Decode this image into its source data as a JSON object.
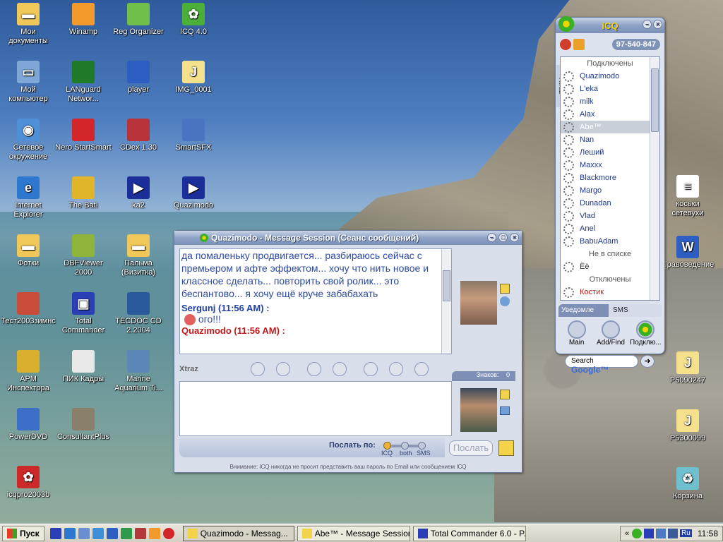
{
  "desktop_icons": [
    {
      "label": "Мои документы",
      "icon": "folder-icon",
      "color": "#f0c85a"
    },
    {
      "label": "Winamp",
      "icon": "winamp-icon",
      "color": "#f29a2b"
    },
    {
      "label": "Reg Organizer",
      "icon": "reg-organizer-icon",
      "color": "#6fbf4a"
    },
    {
      "label": "ICQ 4.0",
      "icon": "icq-flower-icon",
      "color": "#4caf3a"
    },
    {
      "label": "Мой компьютер",
      "icon": "computer-icon",
      "color": "#7ea7d8"
    },
    {
      "label": "LANguard Networ...",
      "icon": "radar-icon",
      "color": "#1f7a2a"
    },
    {
      "label": "player",
      "icon": "player-icon",
      "color": "#2f5ec2"
    },
    {
      "label": "IMG_0001",
      "icon": "jpg-icon",
      "color": "#f5e08c"
    },
    {
      "label": "Сетевое окружение",
      "icon": "network-icon",
      "color": "#4f8fd8"
    },
    {
      "label": "Nero StartSmart",
      "icon": "nero-icon",
      "color": "#d3262b"
    },
    {
      "label": "CDex 1.30",
      "icon": "cdex-icon",
      "color": "#b9333a"
    },
    {
      "label": "SmartSFX",
      "icon": "smartsfx-icon",
      "color": "#4a74c2"
    },
    {
      "label": "Internet Explorer",
      "icon": "ie-icon",
      "color": "#2f78d0"
    },
    {
      "label": "The Bat!",
      "icon": "bat-icon",
      "color": "#e0b52a"
    },
    {
      "label": "ka2",
      "icon": "play-shortcut-icon",
      "color": "#1c2e9a"
    },
    {
      "label": "Quazimodo",
      "icon": "play-shortcut-icon",
      "color": "#1c2e9a"
    },
    {
      "label": "Фотки",
      "icon": "folder-icon",
      "color": "#f0c85a"
    },
    {
      "label": "DBFViewer 2000",
      "icon": "dbf-icon",
      "color": "#8fb43c"
    },
    {
      "label": "Пальма (Визитка)",
      "icon": "folder-icon",
      "color": "#f0c85a"
    },
    {
      "label": "Тест2003зимнс",
      "icon": "house-icon",
      "color": "#c94b3a"
    },
    {
      "label": "Total Commander",
      "icon": "floppy-icon",
      "color": "#2a3fb5"
    },
    {
      "label": "TECDOC CD 2.2004",
      "icon": "tecdoc-icon",
      "color": "#2b5a9c"
    },
    {
      "label": "АРМ Инспектора",
      "icon": "coins-icon",
      "color": "#d8b02d"
    },
    {
      "label": "ПИК Кадры",
      "icon": "window-icon",
      "color": "#e8e8e8"
    },
    {
      "label": "Marine Aquarium Ti...",
      "icon": "fish-icon",
      "color": "#5b86b5"
    },
    {
      "label": "PowerDVD",
      "icon": "dvd-icon",
      "color": "#3d6fc9"
    },
    {
      "label": "ConsultantPlus",
      "icon": "person-icon",
      "color": "#8a7f6b"
    },
    {
      "label": "icqpro2003b",
      "icon": "icq-floppy-icon",
      "color": "#cc2a2a"
    },
    {
      "label": "коськи сетевухи",
      "icon": "text-file-icon",
      "color": "#ffffff"
    },
    {
      "label": "Правоведение",
      "icon": "word-doc-icon",
      "color": "#2f5ec2"
    },
    {
      "label": "P6090247",
      "icon": "jpg-icon",
      "color": "#f5e08c"
    },
    {
      "label": "P5300099",
      "icon": "jpg-icon",
      "color": "#f5e08c"
    },
    {
      "label": "Корзина",
      "icon": "recycle-bin-icon",
      "color": "#6fbfcf"
    }
  ],
  "icq_main": {
    "title": "ICQ",
    "uin": "97-540-847",
    "xtraz_label": "Xtraz",
    "sections": {
      "online": "Подключены",
      "not_in_list": "Не в списке",
      "offline": "Отключены"
    },
    "online_contacts": [
      "Quazimodo",
      "L'eka",
      "milk",
      "Alax",
      "Abe™",
      "Nan",
      "Леший",
      "Maxxx",
      "Blackmore",
      "Margo",
      "Dunadan",
      "Vlad",
      "Anel",
      "BabuAdam"
    ],
    "not_in_list": [
      "Ёё"
    ],
    "offline_contacts": [
      "Костик"
    ],
    "tabs": [
      "Уведомле",
      "SMS"
    ],
    "buttons": [
      "Main",
      "Add/Find",
      "Подклю..."
    ],
    "search_label": "Search",
    "search_brand": "Google™"
  },
  "chat": {
    "title": "Quazimodo - Message Session (Сеанс сообщений)",
    "history_text": "да помаленьку продвигается... разбираюсь сейчас с премьером и афте эффектом... хочу что нить новое и классное сделать... повторить свой ролик... это беспантово... я хочу ещё круче забабахать",
    "msg1_header": "Sergunj (11:56 AM) :",
    "msg1_text": "ого!!!",
    "msg2_header": "Quazimodo (11:56 AM) :",
    "xtraz_label": "Xtraz",
    "char_count_label": "Знаков:",
    "char_count": "0",
    "send_via_label": "Послать по:",
    "send_options": [
      "ICQ",
      "both",
      "SMS"
    ],
    "send_button": "Послать",
    "warning": "Внимание: ICQ никогда не просит представить ваш пароль по Email или сообщением ICQ"
  },
  "taskbar": {
    "start": "Пуск",
    "tasks": [
      "Quazimodo - Messag...",
      "Abe™ - Message Session...",
      "Total Commander 6.0 - P..."
    ],
    "lang": "Ru",
    "time": "11:58"
  }
}
